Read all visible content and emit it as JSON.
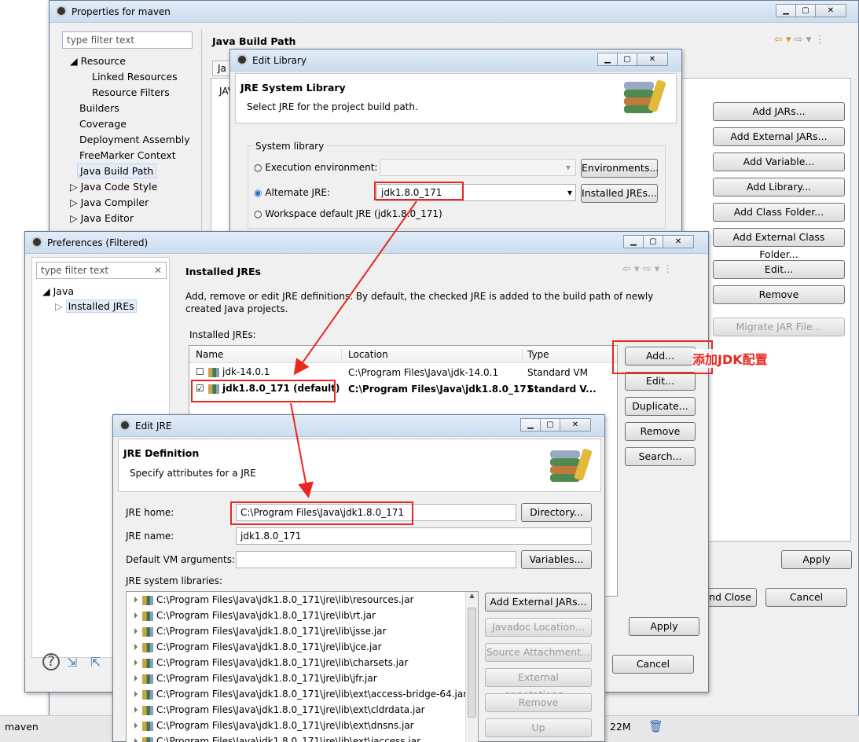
{
  "properties": {
    "title": "Properties for maven",
    "filter_placeholder": "type filter text",
    "heading": "Java Build Path",
    "tree": [
      "Resource",
      "Linked Resources",
      "Resource Filters",
      "Builders",
      "Coverage",
      "Deployment Assembly",
      "FreeMarker Context",
      "Java Build Path",
      "Java Code Style",
      "Java Compiler",
      "Java Editor"
    ],
    "buttons": [
      "Add JARs...",
      "Add External JARs...",
      "Add Variable...",
      "Add Library...",
      "Add Class Folder...",
      "Add External Class Folder...",
      "Edit...",
      "Remove",
      "Migrate JAR File..."
    ],
    "apply": "Apply",
    "apply_close": "and Close",
    "cancel": "Cancel",
    "tab_partial": "Ja",
    "label_partial": "JAV"
  },
  "edit_library": {
    "title": "Edit Library",
    "heading": "JRE System Library",
    "subtitle": "Select JRE for the project build path.",
    "group": "System library",
    "opt_exec": "Execution environment:",
    "opt_alt": "Alternate JRE:",
    "opt_ws": "Workspace default JRE (jdk1.8.0_171)",
    "alt_value": "jdk1.8.0_171",
    "btn_env": "Environments...",
    "btn_installed": "Installed JREs..."
  },
  "preferences": {
    "title": "Preferences (Filtered)",
    "filter_placeholder": "type filter text",
    "tree_java": "Java",
    "tree_installed": "Installed JREs",
    "heading": "Installed JREs",
    "desc": "Add, remove or edit JRE definitions. By default, the checked JRE is added to the build path of newly created Java projects.",
    "installed_label": "Installed JREs:",
    "columns": [
      "Name",
      "Location",
      "Type"
    ],
    "rows": [
      {
        "name": "jdk-14.0.1",
        "location": "C:\\Program Files\\Java\\jdk-14.0.1",
        "type": "Standard VM"
      },
      {
        "name": "jdk1.8.0_171 (default)",
        "location": "C:\\Program Files\\Java\\jdk1.8.0_171",
        "type": "Standard V..."
      }
    ],
    "buttons": [
      "Add...",
      "Edit...",
      "Duplicate...",
      "Remove",
      "Search..."
    ],
    "apply": "Apply",
    "cancel": "Cancel"
  },
  "annotation": "添加JDK配置",
  "edit_jre": {
    "title": "Edit JRE",
    "heading": "JRE Definition",
    "subtitle": "Specify attributes for a JRE",
    "home_label": "JRE home:",
    "home_value": "C:\\Program Files\\Java\\jdk1.8.0_171",
    "name_label": "JRE name:",
    "name_value": "jdk1.8.0_171",
    "args_label": "Default VM arguments:",
    "libs_label": "JRE system libraries:",
    "btn_directory": "Directory...",
    "btn_variables": "Variables...",
    "libs": [
      "C:\\Program Files\\Java\\jdk1.8.0_171\\jre\\lib\\resources.jar",
      "C:\\Program Files\\Java\\jdk1.8.0_171\\jre\\lib\\rt.jar",
      "C:\\Program Files\\Java\\jdk1.8.0_171\\jre\\lib\\jsse.jar",
      "C:\\Program Files\\Java\\jdk1.8.0_171\\jre\\lib\\jce.jar",
      "C:\\Program Files\\Java\\jdk1.8.0_171\\jre\\lib\\charsets.jar",
      "C:\\Program Files\\Java\\jdk1.8.0_171\\jre\\lib\\jfr.jar",
      "C:\\Program Files\\Java\\jdk1.8.0_171\\jre\\lib\\ext\\access-bridge-64.jar",
      "C:\\Program Files\\Java\\jdk1.8.0_171\\jre\\lib\\ext\\cldrdata.jar",
      "C:\\Program Files\\Java\\jdk1.8.0_171\\jre\\lib\\ext\\dnsns.jar",
      "C:\\Program Files\\Java\\jdk1.8.0_171\\jre\\lib\\ext\\jaccess.jar"
    ],
    "lib_buttons": [
      "Add External JARs...",
      "Javadoc Location...",
      "Source Attachment...",
      "External annotations...",
      "Remove",
      "Up"
    ]
  },
  "status": {
    "left": "maven",
    "memory": "22M"
  }
}
